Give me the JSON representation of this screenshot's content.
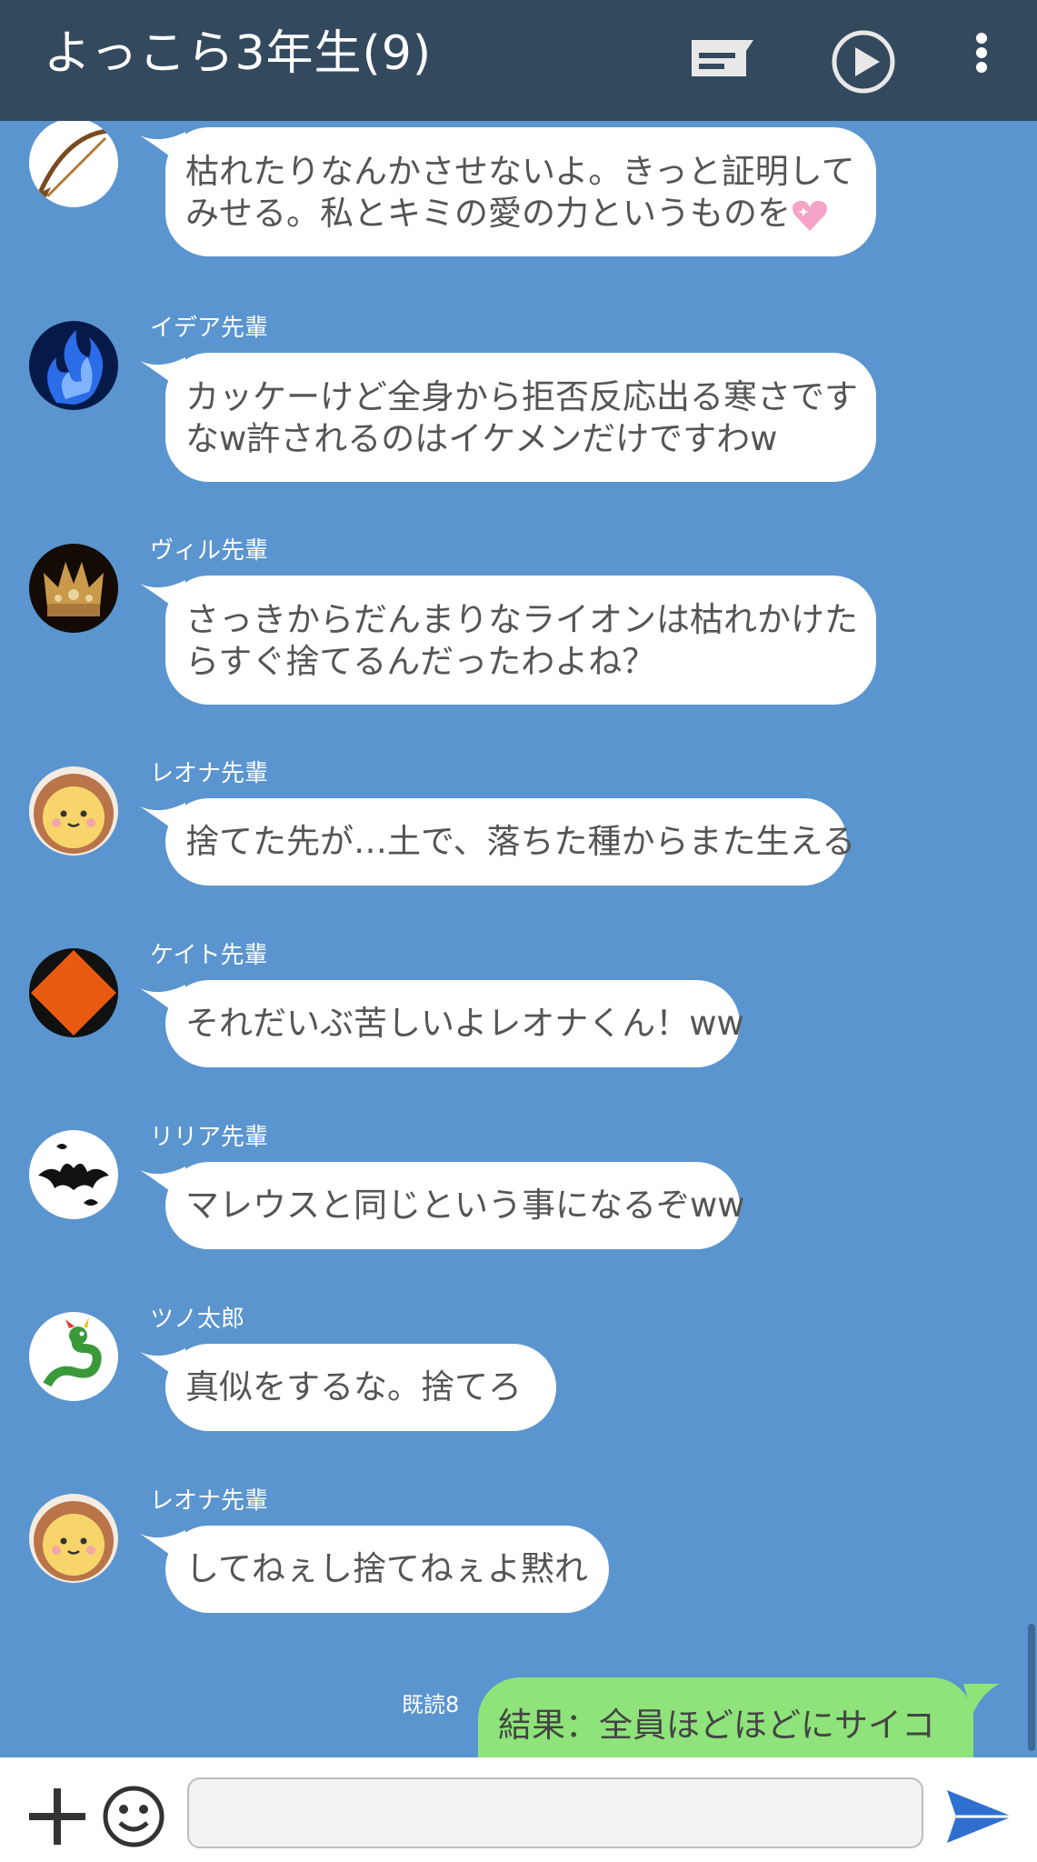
{
  "header": {
    "title": "よっこら3年生(9)",
    "icons": [
      "chat-list-icon",
      "play-icon",
      "more-vertical-icon"
    ]
  },
  "messages": [
    {
      "sender": "",
      "text_line1": "枯れたりなんかさせないよ。きっと証明して",
      "text_line2": "みせる。私とキミの愛の力というものを",
      "emoji": "sparkling-heart-icon",
      "avatar": "avatar-archer"
    },
    {
      "sender": "イデア先輩",
      "text_line1": "カッケーけど全身から拒否反応出る寒さです",
      "text_line2": "なw許されるのはイケメンだけですわw",
      "avatar": "avatar-blue-flame"
    },
    {
      "sender": "ヴィル先輩",
      "text_line1": "さっきからだんまりなライオンは枯れかけた",
      "text_line2": "らすぐ捨てるんだったわよね？",
      "avatar": "avatar-crown"
    },
    {
      "sender": "レオナ先輩",
      "text": "捨てた先が…土で、落ちた種からまた生える",
      "avatar": "avatar-lion"
    },
    {
      "sender": "ケイト先輩",
      "text": "それだいぶ苦しいよレオナくん！ww",
      "avatar": "avatar-orange-diamond"
    },
    {
      "sender": "リリア先輩",
      "text": "マレウスと同じという事になるぞww",
      "avatar": "avatar-bats"
    },
    {
      "sender": "ツノ太郎",
      "text": "真似をするな。捨てろ",
      "avatar": "avatar-dragon"
    },
    {
      "sender": "レオナ先輩",
      "text": "してねぇし捨てねぇよ黙れ",
      "avatar": "avatar-lion"
    }
  ],
  "my_message": {
    "read_label": "既読8",
    "text": "結果：全員ほどほどにサイコ"
  },
  "input": {
    "value": "",
    "placeholder": "",
    "icons": [
      "plus-icon",
      "smiley-icon",
      "send-icon"
    ]
  },
  "colors": {
    "header_bg": "#33495e",
    "chat_bg": "#5b95cf",
    "my_bubble": "#8ee37a",
    "send": "#2f6fd0"
  }
}
